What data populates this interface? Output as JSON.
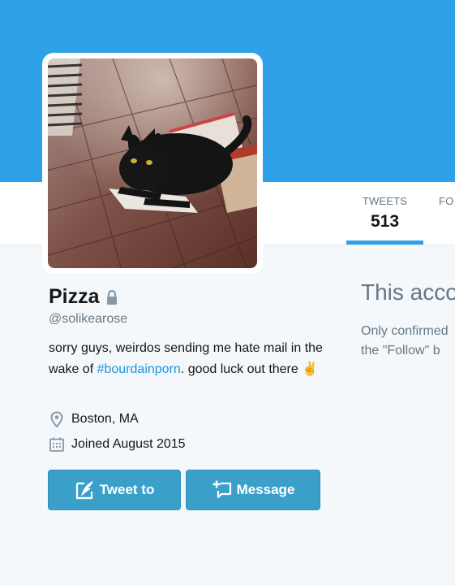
{
  "colors": {
    "banner": "#2ea1e8",
    "accent": "#2ea1e8",
    "button": "#3ba0c9",
    "link": "#1b95e0"
  },
  "nav": {
    "stats": [
      {
        "label": "TWEETS",
        "value": "513"
      },
      {
        "label": "FO",
        "value": ""
      }
    ]
  },
  "profile": {
    "name": "Pizza",
    "handle": "@solikearose",
    "bio_before": "sorry guys, weirdos sending me hate mail in the wake of ",
    "bio_hashtag": "#bourdainporn",
    "bio_after": ". good luck out there ",
    "bio_emoji": "✌",
    "location": "Boston, MA",
    "joined": "Joined August 2015",
    "icons": {
      "lock": "lock-icon",
      "location": "location-pin-icon",
      "calendar": "calendar-icon",
      "tweet_to": "compose-quill-icon",
      "message": "message-plus-icon"
    }
  },
  "actions": {
    "tweet_to": "Tweet to",
    "message": "Message"
  },
  "protected": {
    "title": "This acco",
    "line1": "Only confirmed",
    "line2": "the \"Follow\" b"
  }
}
